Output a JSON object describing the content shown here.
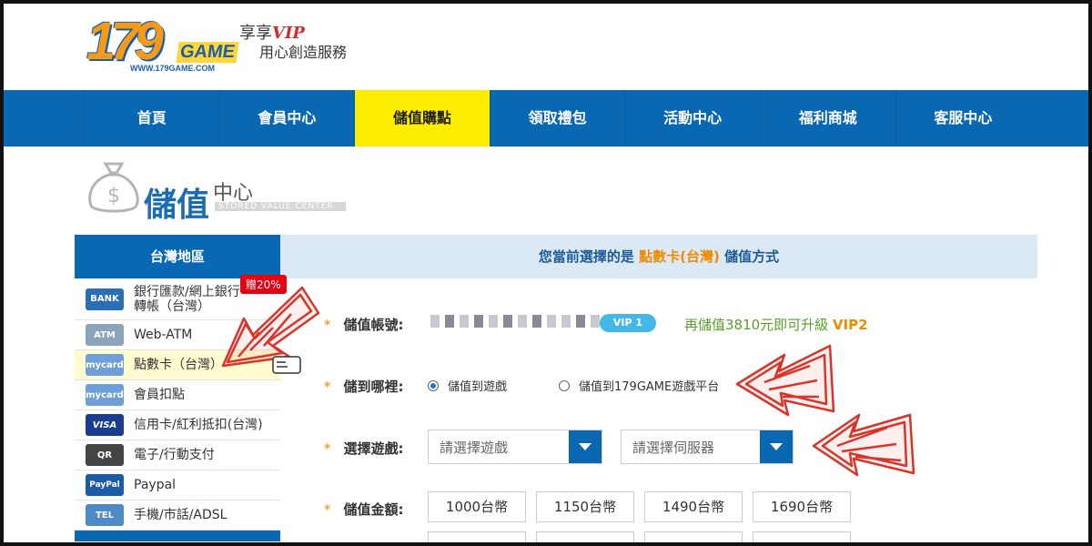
{
  "header": {
    "logo_number": "179",
    "logo_game": "GAME",
    "logo_url": "WWW.179GAME.COM",
    "slogan_line1": "享享",
    "slogan_vip": "VIP",
    "slogan_line2": "用心創造服務"
  },
  "nav": {
    "items": [
      {
        "label": "首頁"
      },
      {
        "label": "會員中心"
      },
      {
        "label": "儲值購點"
      },
      {
        "label": "領取禮包"
      },
      {
        "label": "活動中心"
      },
      {
        "label": "福利商城"
      },
      {
        "label": "客服中心"
      }
    ],
    "active_index": 2
  },
  "page_title": {
    "big": "儲值",
    "small": "中心",
    "en": "STORED VALUE CENTER"
  },
  "sidebar": {
    "title": "台灣地區",
    "badge": "贈20%",
    "items": [
      {
        "label": "銀行匯款/網上銀行轉帳（台灣）",
        "icon": "bank-icon",
        "icon_text": "BANK",
        "icon_color": "#2a6fb6"
      },
      {
        "label": "Web-ATM",
        "icon": "atm-icon",
        "icon_text": "ATM",
        "icon_color": "#8aa4bd"
      },
      {
        "label": "點數卡（台灣）",
        "icon": "mycard-icon",
        "icon_text": "mycard",
        "icon_color": "#6f9fd6"
      },
      {
        "label": "會員扣點",
        "icon": "mycard-icon",
        "icon_text": "mycard",
        "icon_color": "#6f9fd6"
      },
      {
        "label": "信用卡/紅利抵扣(台灣)",
        "icon": "visa-icon",
        "icon_text": "VISA",
        "icon_color": "#1a3d8f"
      },
      {
        "label": "電子/行動支付",
        "icon": "qr-icon",
        "icon_text": "QR",
        "icon_color": "#444444"
      },
      {
        "label": "Paypal",
        "icon": "paypal-icon",
        "icon_text": "PayPal",
        "icon_color": "#1d5ba8"
      },
      {
        "label": "手機/市話/ADSL",
        "icon": "phone-icon",
        "icon_text": "TEL",
        "icon_color": "#4e8bc4"
      }
    ],
    "active_index": 2
  },
  "main": {
    "head_prefix": "您當前選擇的是 ",
    "head_method": "點數卡(台灣)",
    "head_suffix": " 儲值方式",
    "account_label": "儲值帳號:",
    "vip_badge": "VIP 1",
    "upgrade_text": "再儲值3810元即可升級 ",
    "upgrade_level": "VIP2",
    "target_label": "儲到哪裡:",
    "target_options": [
      "儲值到遊戲",
      "儲值到179GAME遊戲平台"
    ],
    "target_selected": 0,
    "game_label": "選擇遊戲:",
    "game_placeholder": "請選擇遊戲",
    "server_placeholder": "請選擇伺服器",
    "amount_label": "儲值金額:",
    "amounts": [
      "1000台幣",
      "1150台幣",
      "1490台幣",
      "1690台幣"
    ]
  },
  "colors": {
    "nav_blue": "#0a67b2",
    "active_yellow": "#ffed00",
    "accent_orange": "#f08a00",
    "annotation_red": "#d8352a"
  }
}
